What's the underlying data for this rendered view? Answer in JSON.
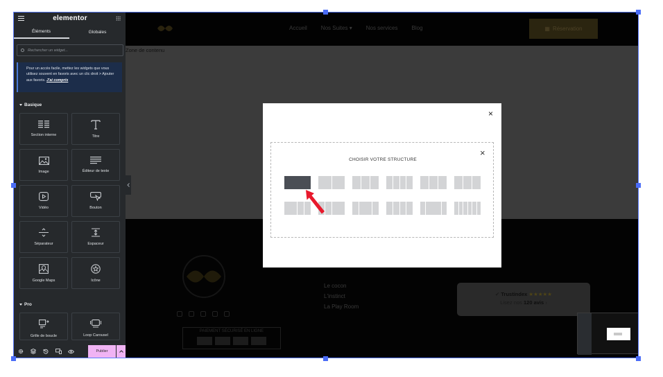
{
  "sidebar": {
    "logo": "elementor",
    "tabs": [
      "Éléments",
      "Globales"
    ],
    "search_placeholder": "Rechercher un widget...",
    "tip_text": "Pour un accès facile, mettez les widgets que vous utilisez souvent en favoris avec un clic droit > Ajouter aux favoris.",
    "tip_link": "J'ai compris",
    "category_basic": "Basique",
    "widgets": [
      "Section interne",
      "Titre",
      "Image",
      "Éditeur de texte",
      "Vidéo",
      "Bouton",
      "Séparateur",
      "Espaceur",
      "Google Maps",
      "Icône"
    ],
    "category_pro": "Pro",
    "pro_widgets": [
      "Grille de boucle",
      "Loop Carousel"
    ],
    "publish_label": "Publier"
  },
  "site": {
    "nav": [
      "Accueil",
      "Nos Suites ▾",
      "Nos services",
      "Blog"
    ],
    "reservation_label": "Réservation",
    "zone_label": "Zone de contenu",
    "footer_links": [
      "Le cocon",
      "L'instinct",
      "La Play Room"
    ],
    "payment_label": "PAIEMENT SÉCURISÉ EN LIGNE",
    "trust_brand": "Trustindex",
    "trust_stars": "★★★★★",
    "trust_text_pre": "Lisez nos",
    "trust_count": "120 avis",
    "trust_suffix": "›"
  },
  "modal": {
    "close_glyph": "×",
    "structure_title": "CHOISIR VOTRE STRUCTURE",
    "structure_close_glyph": "×",
    "structures_row1": [
      1,
      2,
      3,
      4,
      3,
      3
    ],
    "structures_row2": [
      3,
      3,
      3,
      4,
      3,
      6
    ],
    "selected_index": 0
  },
  "colors": {
    "accent_publish": "#f0b3f4",
    "selection_blue": "#4a6cf7",
    "sidebar_bg": "#26292c",
    "arrow_red": "#e8192c"
  }
}
